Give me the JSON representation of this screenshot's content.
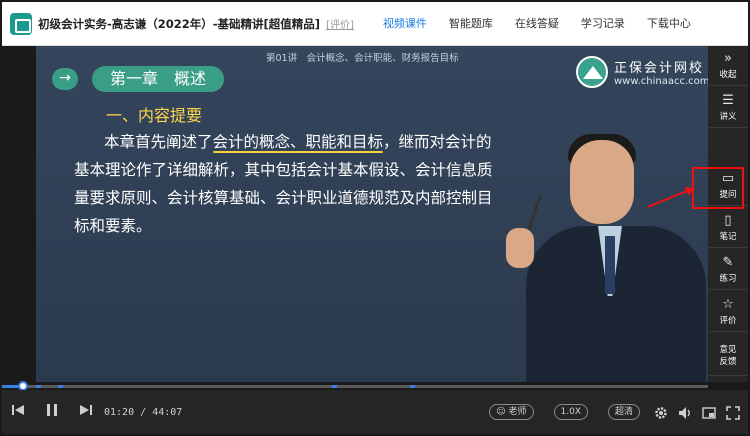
{
  "header": {
    "course_title": "初级会计实务-高志谦（2022年）-基础精讲[超值精品]",
    "eval_link": "[评价]",
    "nav": [
      {
        "label": "视频课件",
        "active": true
      },
      {
        "label": "智能题库",
        "active": false
      },
      {
        "label": "在线答疑",
        "active": false
      },
      {
        "label": "学习记录",
        "active": false
      },
      {
        "label": "下载中心",
        "active": false
      }
    ]
  },
  "slide": {
    "lecture_caption": "第01讲　会计概念、会计职能、财务报告目标",
    "brand_name": "正保会计网校",
    "brand_url": "www.chinaacc.com",
    "arrow_glyph": "→",
    "chapter": "第一章　概述",
    "section": "一、内容提要",
    "body_line1_pre": "本章首先阐述了",
    "body_line1_hl": "会计的概念、职能和目标",
    "body_line1_post": "，继而对会计的",
    "body_line2": "基本理论作了详细解析，其中包括会计基本假设、会计信息质",
    "body_line3": "量要求原则、会计核算基础、会计职业道德规范及内部控制目",
    "body_line4": "标和要素。"
  },
  "sidebar": [
    {
      "icon": "»",
      "label": "收起",
      "name": "collapse"
    },
    {
      "icon": "☰",
      "label": "讲义",
      "name": "handout"
    },
    {
      "icon": "▭",
      "label": "提问",
      "name": "ask"
    },
    {
      "icon": "▯",
      "label": "笔记",
      "name": "notes"
    },
    {
      "icon": "✎",
      "label": "练习",
      "name": "practice"
    },
    {
      "icon": "☆",
      "label": "评价",
      "name": "rate"
    },
    {
      "icon": "",
      "label": "意见反馈",
      "name": "feedback"
    }
  ],
  "player": {
    "progress": 0.03,
    "current_time": "01:20",
    "separator": "/",
    "total_time": "44:07",
    "teacher_toggle": "老师",
    "speed": "1.0X",
    "quality": "超清",
    "accent_color": "#3b7ee6"
  }
}
